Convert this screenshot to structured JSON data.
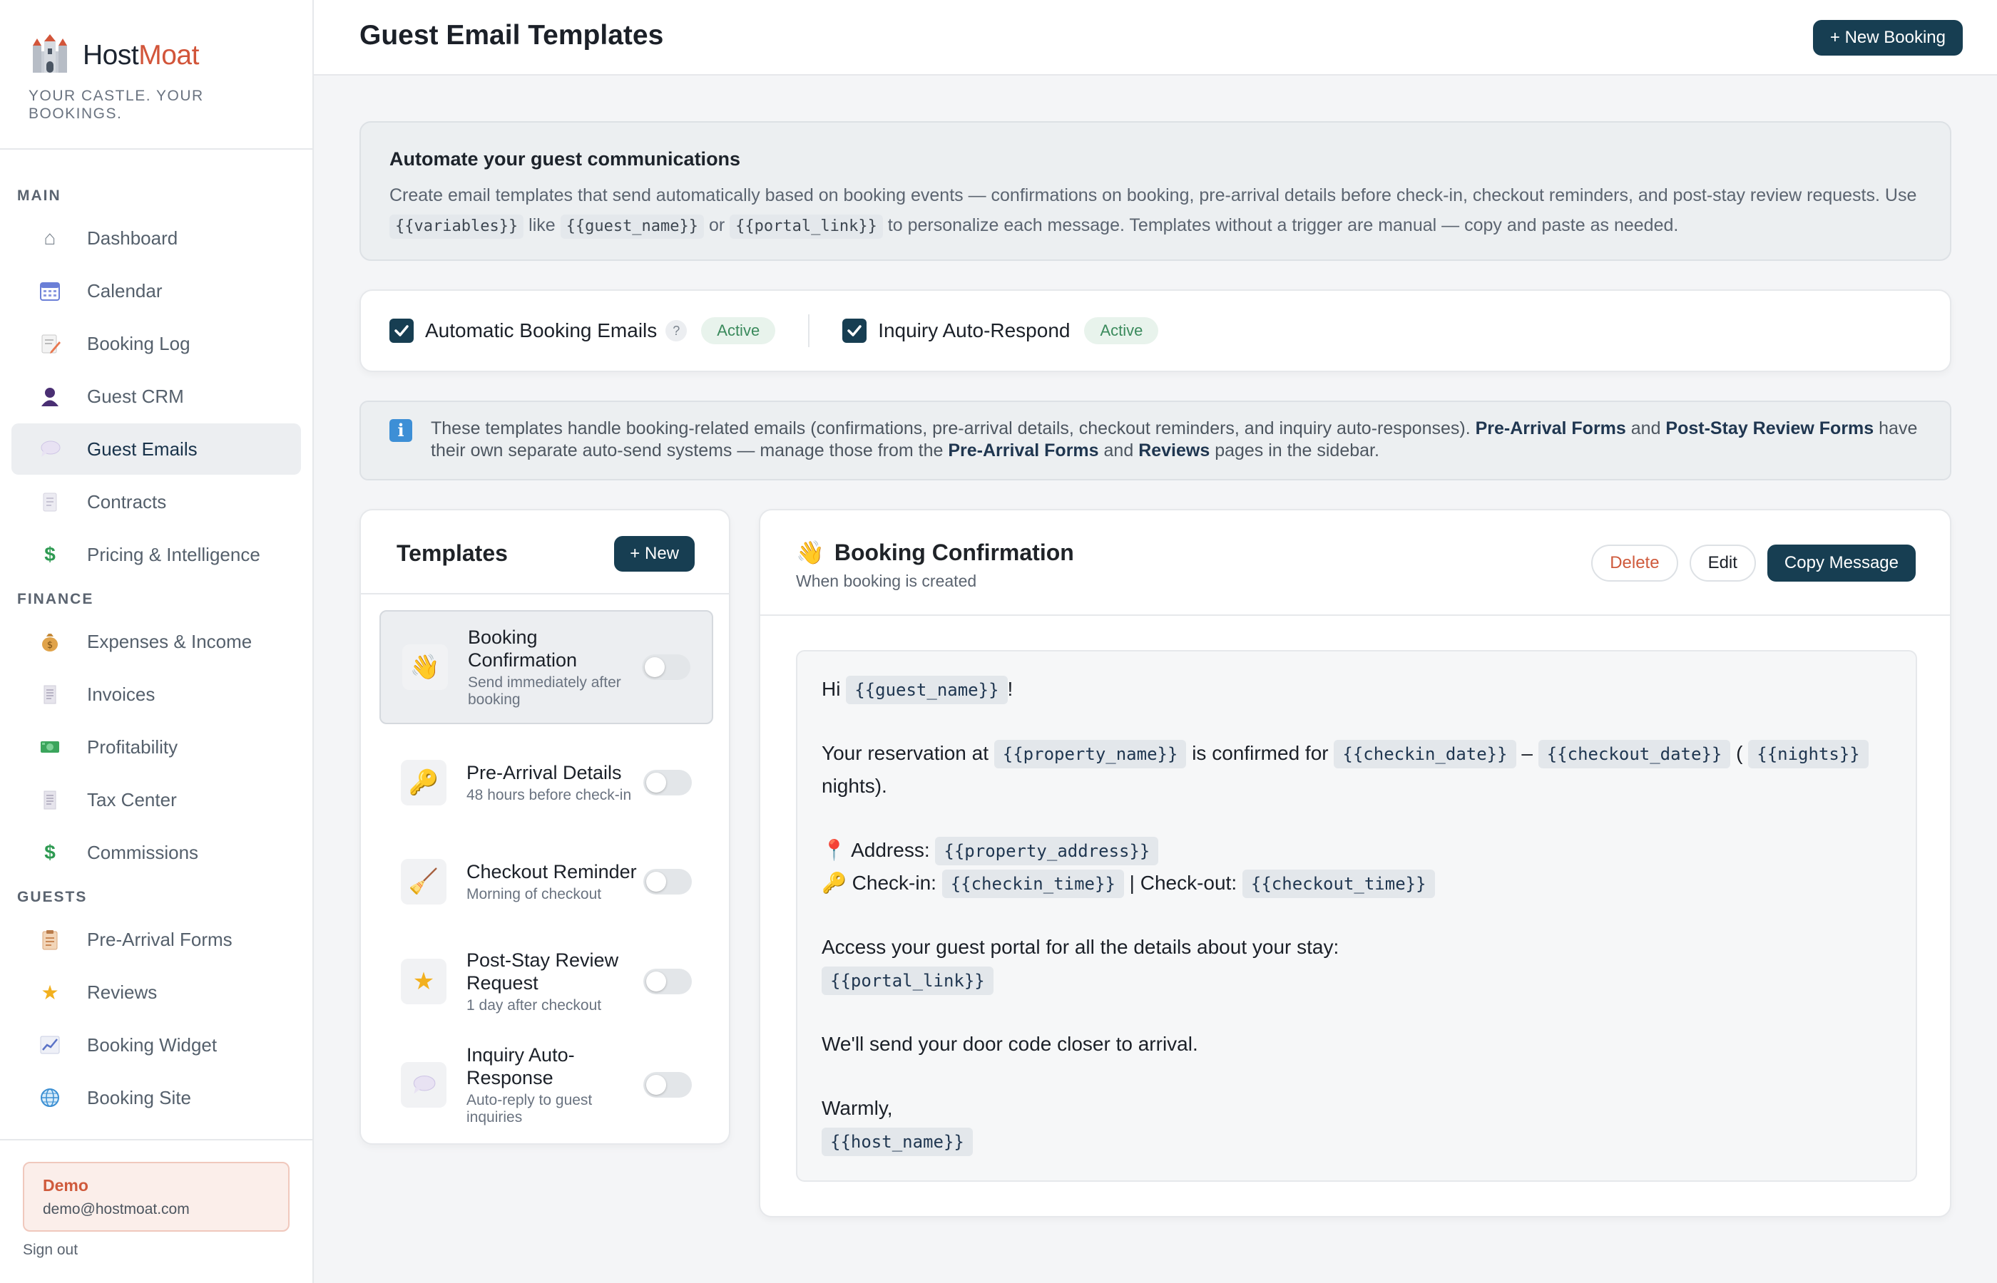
{
  "brand": {
    "name_main": "Host",
    "name_accent": "Moat",
    "tagline": "YOUR CASTLE. YOUR BOOKINGS."
  },
  "nav": {
    "main_label": "MAIN",
    "main": [
      {
        "label": "Dashboard",
        "icon": "home-icon"
      },
      {
        "label": "Calendar",
        "icon": "calendar-icon"
      },
      {
        "label": "Booking Log",
        "icon": "memo-icon"
      },
      {
        "label": "Guest CRM",
        "icon": "person-icon"
      },
      {
        "label": "Guest Emails",
        "icon": "speech-bubble-icon",
        "active": true
      },
      {
        "label": "Contracts",
        "icon": "document-icon"
      },
      {
        "label": "Pricing & Intelligence",
        "icon": "dollar-icon"
      }
    ],
    "finance_label": "FINANCE",
    "finance": [
      {
        "label": "Expenses & Income",
        "icon": "money-bag-icon"
      },
      {
        "label": "Invoices",
        "icon": "receipt-icon"
      },
      {
        "label": "Profitability",
        "icon": "banknote-icon"
      },
      {
        "label": "Tax Center",
        "icon": "receipt-icon"
      },
      {
        "label": "Commissions",
        "icon": "dollar-icon"
      }
    ],
    "guests_label": "GUESTS",
    "guests": [
      {
        "label": "Pre-Arrival Forms",
        "icon": "clipboard-icon"
      },
      {
        "label": "Reviews",
        "icon": "star-icon"
      },
      {
        "label": "Booking Widget",
        "icon": "chart-icon"
      },
      {
        "label": "Booking Site",
        "icon": "globe-icon"
      }
    ]
  },
  "user": {
    "name": "Demo",
    "email": "demo@hostmoat.com",
    "signout": "Sign out"
  },
  "header": {
    "title": "Guest Email Templates",
    "new_booking": "+ New Booking"
  },
  "intro": {
    "title": "Automate your guest communications",
    "text_1": "Create email templates that send automatically based on booking events — confirmations on booking, pre-arrival details before check-in, checkout reminders, and post-stay review requests. Use ",
    "tok_1": "{{variables}}",
    "text_2": " like ",
    "tok_2": "{{guest_name}}",
    "text_3": " or ",
    "tok_3": "{{portal_link}}",
    "text_4": " to personalize each message. Templates without a trigger are manual — copy and paste as needed."
  },
  "toggles": {
    "auto_booking": {
      "label": "Automatic Booking Emails",
      "help": "?",
      "status": "Active",
      "checked": true
    },
    "inquiry": {
      "label": "Inquiry Auto-Respond",
      "status": "Active",
      "checked": true
    }
  },
  "note": {
    "t1": "These templates handle booking-related emails (confirmations, pre-arrival details, checkout reminders, and inquiry auto-responses). ",
    "b1": "Pre-Arrival Forms",
    "t2": " and ",
    "b2": "Post-Stay Review Forms",
    "t3": " have their own separate auto-send systems — manage those from the ",
    "b3": "Pre-Arrival Forms",
    "t4": " and ",
    "b4": "Reviews",
    "t5": " pages in the sidebar."
  },
  "templates": {
    "title": "Templates",
    "new": "+ New",
    "items": [
      {
        "name": "Booking Confirmation",
        "sub": "Send immediately after booking",
        "icon": "waving-hand-icon",
        "enabled": false,
        "selected": true
      },
      {
        "name": "Pre-Arrival Details",
        "sub": "48 hours before check-in",
        "icon": "key-icon",
        "enabled": false
      },
      {
        "name": "Checkout Reminder",
        "sub": "Morning of checkout",
        "icon": "broom-icon",
        "enabled": false
      },
      {
        "name": "Post-Stay Review Request",
        "sub": "1 day after checkout",
        "icon": "star-icon",
        "enabled": false
      },
      {
        "name": "Inquiry Auto-Response",
        "sub": "Auto-reply to guest inquiries",
        "icon": "speech-bubble-icon",
        "enabled": false
      }
    ]
  },
  "detail": {
    "icon": "waving-hand-icon",
    "title": "Booking Confirmation",
    "trigger": "When booking is created",
    "delete": "Delete",
    "edit": "Edit",
    "copy": "Copy Message",
    "msg": {
      "hi": "Hi",
      "guest_name": "{{guest_name}}",
      "excl": "!",
      "res_1": "Your reservation at",
      "property_name": "{{property_name}}",
      "res_2": "is confirmed for",
      "checkin_date": "{{checkin_date}}",
      "dash": "–",
      "checkout_date": "{{checkout_date}}",
      "paren": "(",
      "nights": "{{nights}}",
      "nights_label": "nights).",
      "address_label": "Address:",
      "property_address": "{{property_address}}",
      "checkin_label": "Check-in:",
      "checkin_time": "{{checkin_time}}",
      "checkout_label": "| Check-out:",
      "checkout_time": "{{checkout_time}}",
      "portal_text": "Access your guest portal for all the details about your stay:",
      "portal_link": "{{portal_link}}",
      "door_code": "We'll send your door code closer to arrival.",
      "warmly": "Warmly,",
      "host_name": "{{host_name}}"
    }
  },
  "colors": {
    "brand_dark": "#173e52",
    "accent": "#d2553a",
    "active_green": "#3a8a5c"
  }
}
